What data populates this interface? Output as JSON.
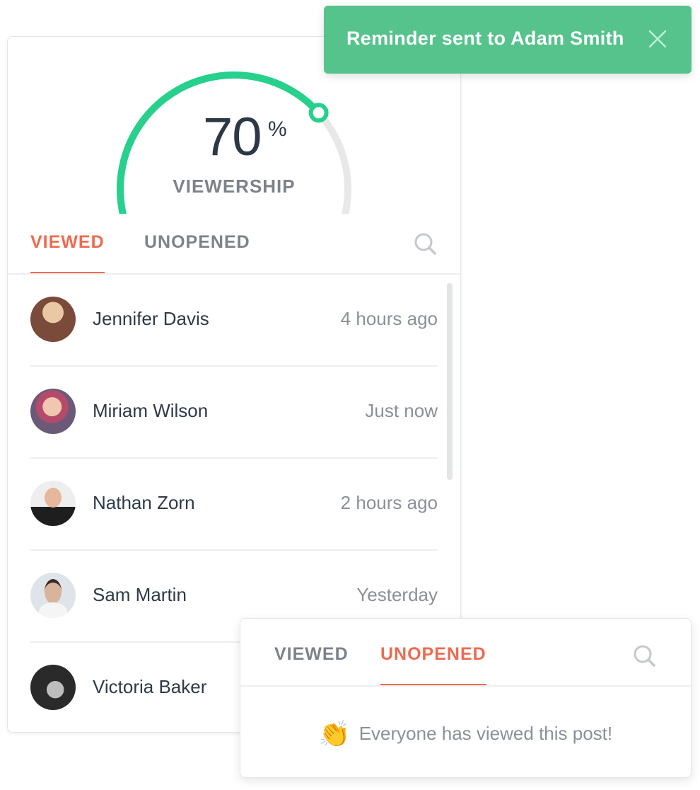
{
  "toast": {
    "message": "Reminder sent to Adam Smith",
    "close_icon": "close-icon",
    "color": "#55c38b"
  },
  "viewership": {
    "percent_value": 70,
    "value_text": "70",
    "unit": "%",
    "caption": "VIEWERSHIP",
    "accent_color": "#27d08c",
    "track_color": "#e8e8e8"
  },
  "main_panel": {
    "tabs": [
      {
        "label": "VIEWED",
        "active": true
      },
      {
        "label": "UNOPENED",
        "active": false
      }
    ],
    "search_icon": "search-icon",
    "viewers": [
      {
        "name": "Jennifer Davis",
        "time": "4 hours ago",
        "avatar_color": "#7a4a3a"
      },
      {
        "name": "Miriam Wilson",
        "time": "Just now",
        "avatar_color": "#8a6a8a"
      },
      {
        "name": "Nathan Zorn",
        "time": "2 hours ago",
        "avatar_color": "#2b2b2b"
      },
      {
        "name": "Sam Martin",
        "time": "Yesterday",
        "avatar_color": "#c9b7a8"
      },
      {
        "name": "Victoria Baker",
        "time": "",
        "avatar_color": "#3a3a3a"
      }
    ]
  },
  "secondary_panel": {
    "tabs": [
      {
        "label": "VIEWED",
        "active": false
      },
      {
        "label": "UNOPENED",
        "active": true
      }
    ],
    "search_icon": "search-icon",
    "empty_icon": "clapping-hands-icon",
    "empty_message": "Everyone has viewed this post!"
  },
  "colors": {
    "active_tab": "#ee6a50",
    "inactive_tab": "#7d8289"
  }
}
